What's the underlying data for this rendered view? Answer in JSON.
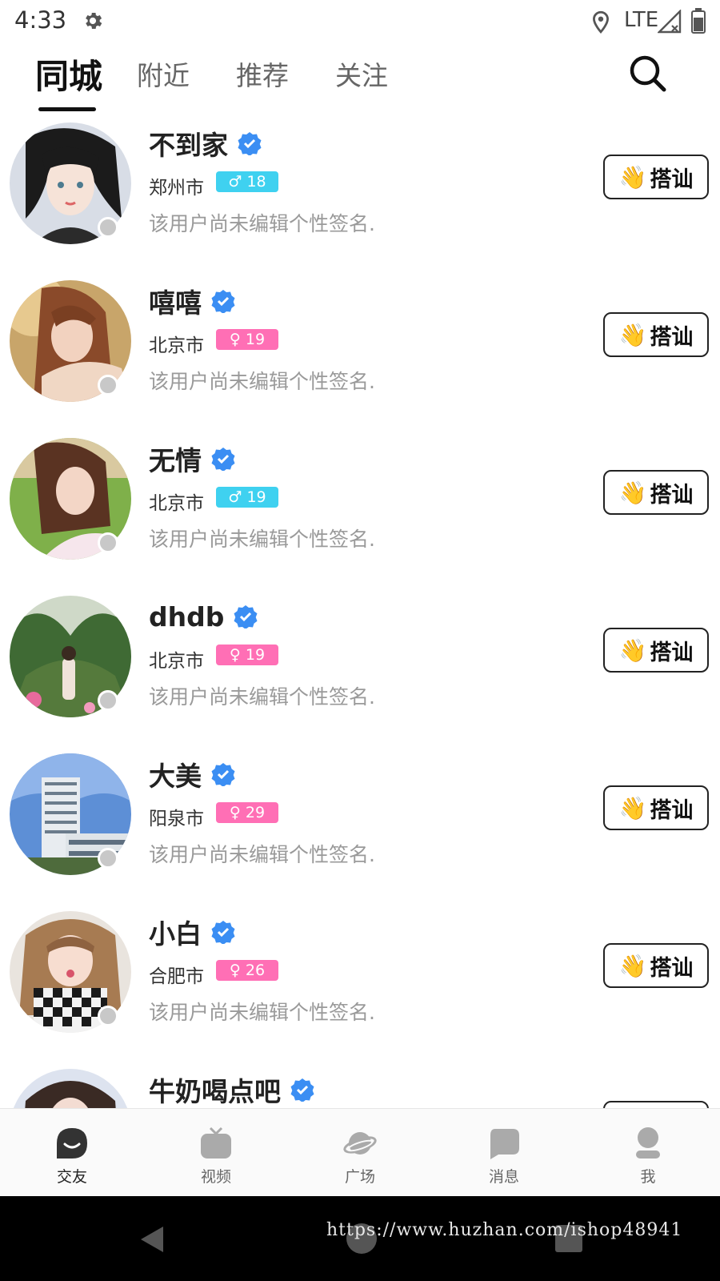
{
  "status_bar": {
    "time": "4:33",
    "network": "LTE"
  },
  "tabs": [
    {
      "label": "同城",
      "active": true
    },
    {
      "label": "附近",
      "active": false
    },
    {
      "label": "推荐",
      "active": false
    },
    {
      "label": "关注",
      "active": false
    }
  ],
  "colors": {
    "male_badge": "#3fd1f0",
    "female_badge": "#ff6fb5",
    "verified": "#3b8ef3"
  },
  "users": [
    {
      "name": "不到家",
      "city": "郑州市",
      "gender": "male",
      "gender_symbol": "♂",
      "age": "18",
      "signature": "该用户尚未编辑个性签名.",
      "button": "搭讪"
    },
    {
      "name": "嘻嘻",
      "city": "北京市",
      "gender": "female",
      "gender_symbol": "♀",
      "age": "19",
      "signature": "该用户尚未编辑个性签名.",
      "button": "搭讪"
    },
    {
      "name": "无情",
      "city": "北京市",
      "gender": "male",
      "gender_symbol": "♂",
      "age": "19",
      "signature": "该用户尚未编辑个性签名.",
      "button": "搭讪"
    },
    {
      "name": "dhdb",
      "city": "北京市",
      "gender": "female",
      "gender_symbol": "♀",
      "age": "19",
      "signature": "该用户尚未编辑个性签名.",
      "button": "搭讪"
    },
    {
      "name": "大美",
      "city": "阳泉市",
      "gender": "female",
      "gender_symbol": "♀",
      "age": "29",
      "signature": "该用户尚未编辑个性签名.",
      "button": "搭讪"
    },
    {
      "name": "小白",
      "city": "合肥市",
      "gender": "female",
      "gender_symbol": "♀",
      "age": "26",
      "signature": "该用户尚未编辑个性签名.",
      "button": "搭讪"
    },
    {
      "name": "牛奶喝点吧",
      "city": "",
      "gender": "",
      "gender_symbol": "",
      "age": "",
      "signature": "",
      "button": ""
    }
  ],
  "bottom_nav": [
    {
      "label": "交友",
      "icon": "chat-bubble-smile-icon",
      "active": true
    },
    {
      "label": "视频",
      "icon": "tv-icon",
      "active": false
    },
    {
      "label": "广场",
      "icon": "planet-icon",
      "active": false
    },
    {
      "label": "消息",
      "icon": "message-icon",
      "active": false
    },
    {
      "label": "我",
      "icon": "person-icon",
      "active": false
    }
  ],
  "watermark": "https://www.huzhan.com/ishop48941"
}
